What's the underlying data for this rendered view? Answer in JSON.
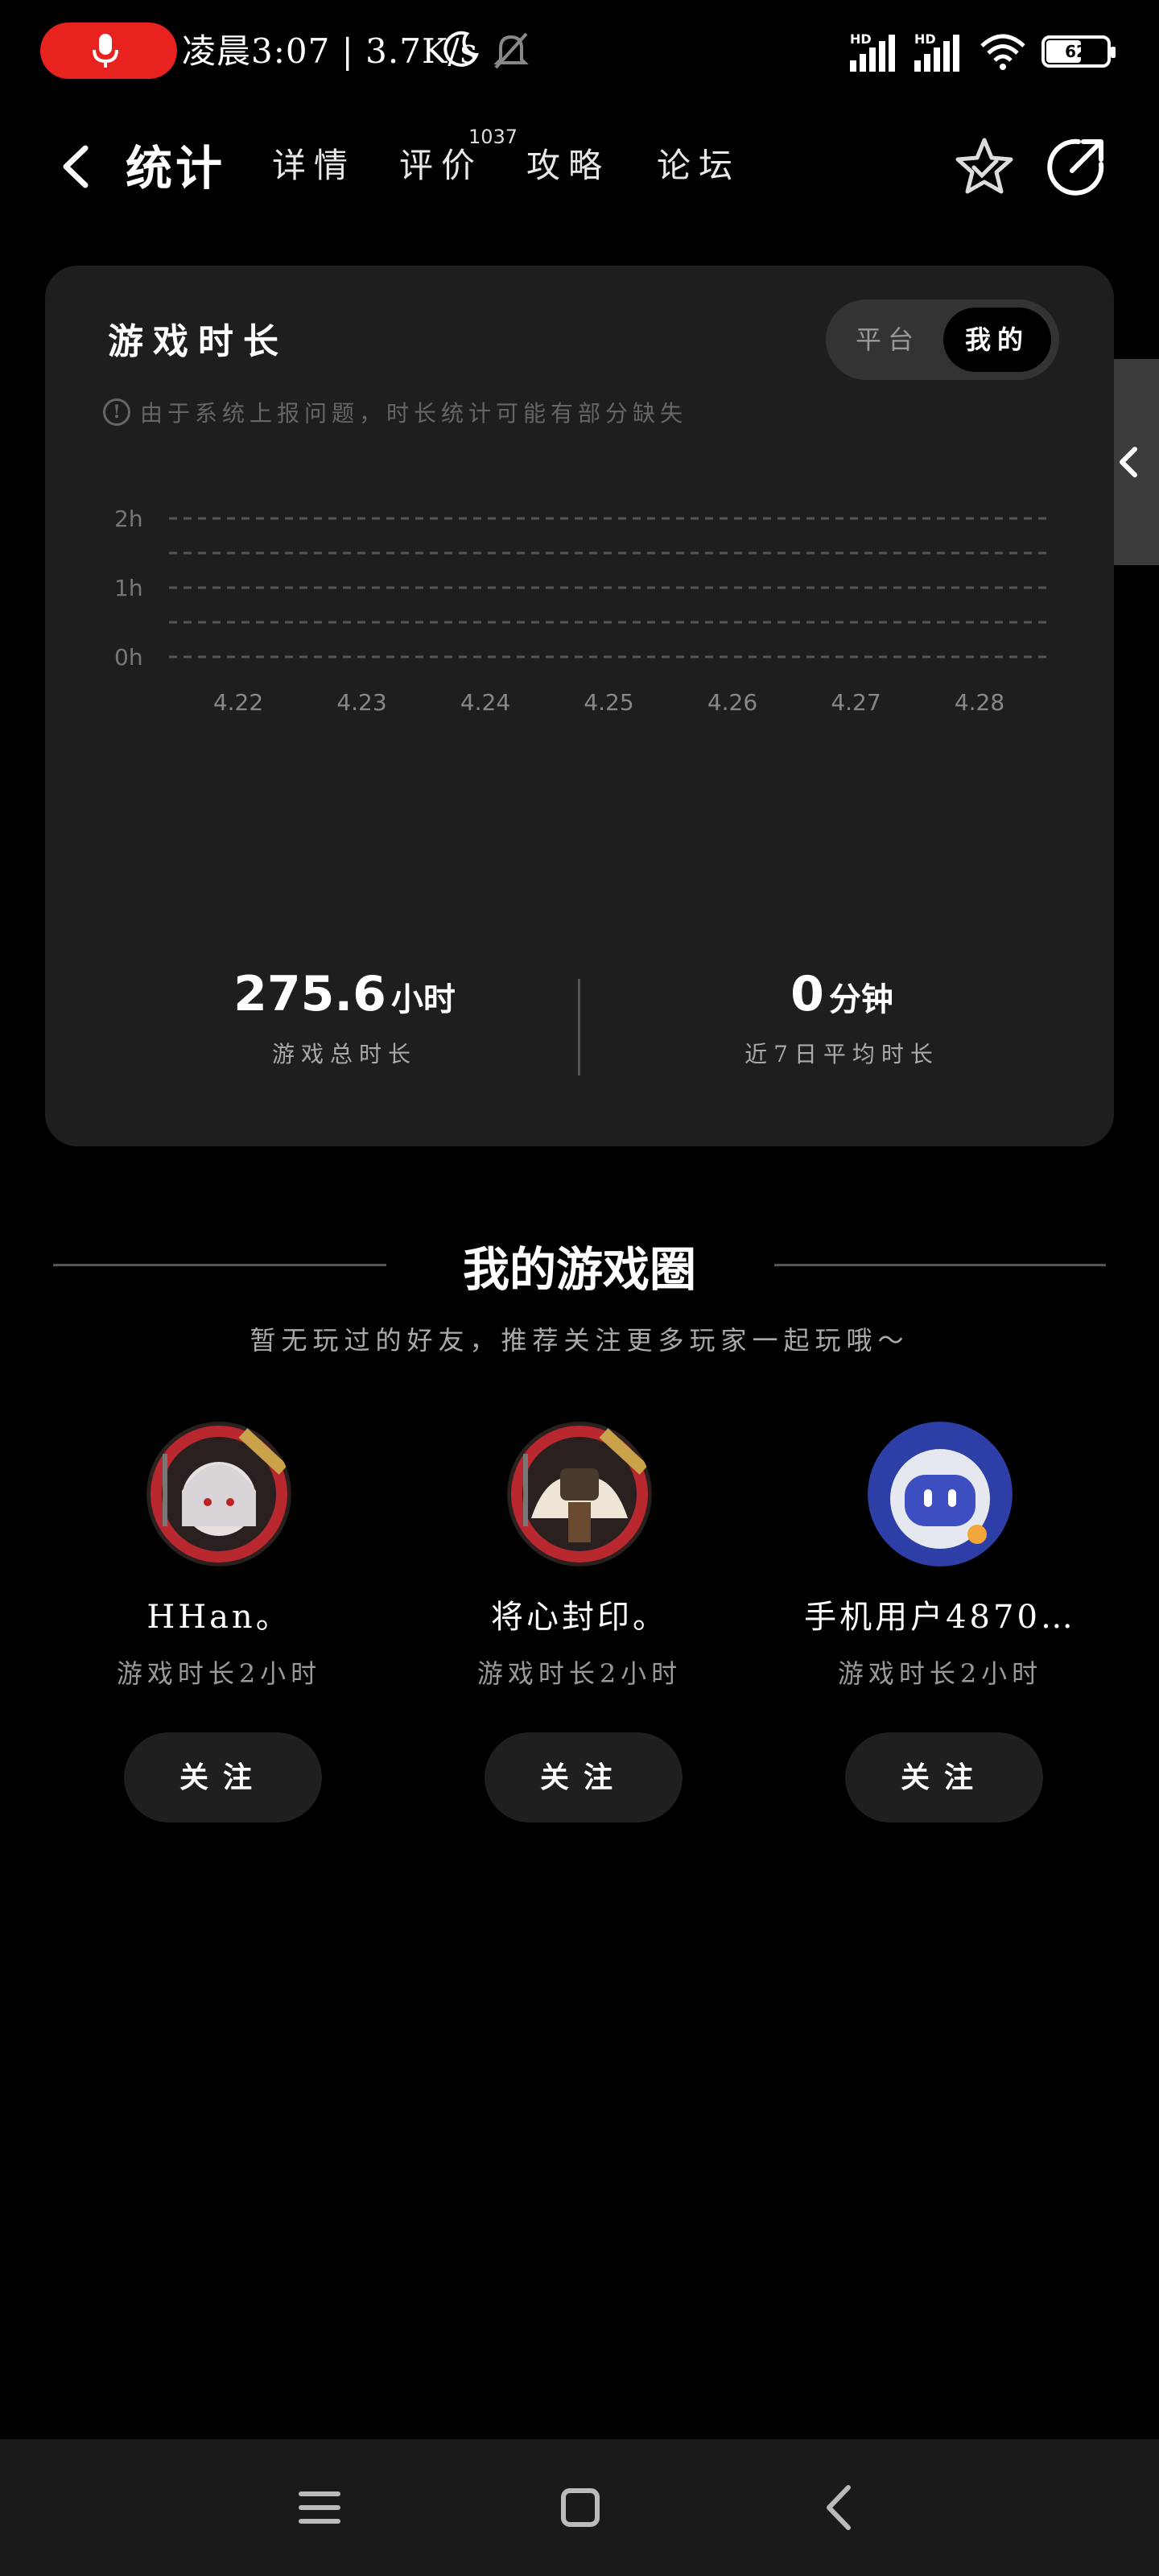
{
  "status_bar": {
    "time_text": "凌晨3:07 | 3.7K/s",
    "hd_label": "HD",
    "battery": "62",
    "battery_level": 0.62
  },
  "nav": {
    "tabs": [
      {
        "label": "统计",
        "active": true
      },
      {
        "label": "详情"
      },
      {
        "label": "评价",
        "badge": "1037"
      },
      {
        "label": "攻略"
      },
      {
        "label": "论坛"
      }
    ]
  },
  "stats_card": {
    "title": "游戏时长",
    "segment": {
      "platform": "平台",
      "mine": "我的"
    },
    "notice": "由于系统上报问题，时长统计可能有部分缺失",
    "total": {
      "value": "275.6",
      "unit": "小时",
      "label": "游戏总时长"
    },
    "avg7": {
      "value": "0",
      "unit": "分钟",
      "label": "近7日平均时长"
    }
  },
  "chart_data": {
    "type": "bar",
    "categories": [
      "4.22",
      "4.23",
      "4.24",
      "4.25",
      "4.26",
      "4.27",
      "4.28"
    ],
    "values": [
      0,
      0,
      0,
      0,
      0,
      0,
      0
    ],
    "ylim": [
      0,
      2
    ],
    "yticks": [
      "0h",
      "1h",
      "2h"
    ],
    "grid": true,
    "title": "",
    "xlabel": "",
    "ylabel": ""
  },
  "circle": {
    "title": "我的游戏圈",
    "subtitle": "暂无玩过的好友，推荐关注更多玩家一起玩哦～",
    "friends": [
      {
        "name": "HHan。",
        "time": "游戏时长2小时",
        "button": "关注"
      },
      {
        "name": "将心封印。",
        "time": "游戏时长2小时",
        "button": "关注"
      },
      {
        "name": "手机用户4870…",
        "time": "游戏时长2小时",
        "button": "关注"
      }
    ]
  },
  "colors": {
    "accent": "#20c9b4",
    "record": "#e8221f",
    "card_bg": "#1e1e1e"
  }
}
